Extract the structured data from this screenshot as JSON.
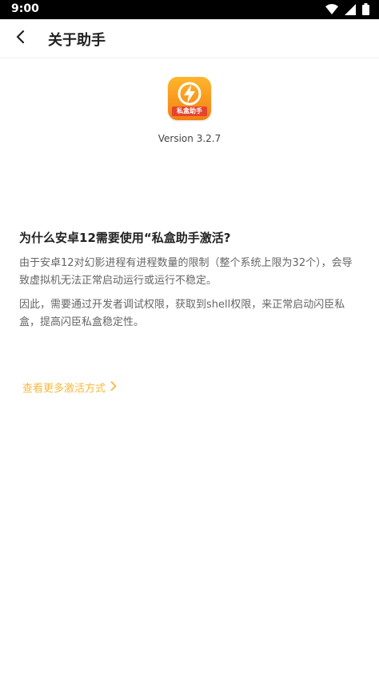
{
  "status": {
    "time": "9:00"
  },
  "header": {
    "title": "关于助手"
  },
  "app": {
    "icon_label": "私盒助手",
    "version": "Version 3.2.7"
  },
  "content": {
    "heading": "为什么安卓12需要使用“私盒助手激活?",
    "paragraph1": "由于安卓12对幻影进程有进程数量的限制（整个系统上限为32个），会导致虚拟机无法正常启动运行或运行不稳定。",
    "paragraph2": "因此，需要通过开发者调试权限，获取到shell权限，来正常启动闪臣私盒，提高闪臣私盒稳定性。",
    "more_link": "查看更多激活方式"
  },
  "colors": {
    "accent": "#f7b93b",
    "icon_gradient_top": "#ffb62c",
    "icon_gradient_bottom": "#f27f13",
    "icon_label_bg": "#e4432e"
  },
  "icons": [
    "wifi-icon",
    "signal-icon",
    "battery-icon",
    "back-arrow-icon",
    "lightning-icon",
    "chevron-right-icon"
  ]
}
